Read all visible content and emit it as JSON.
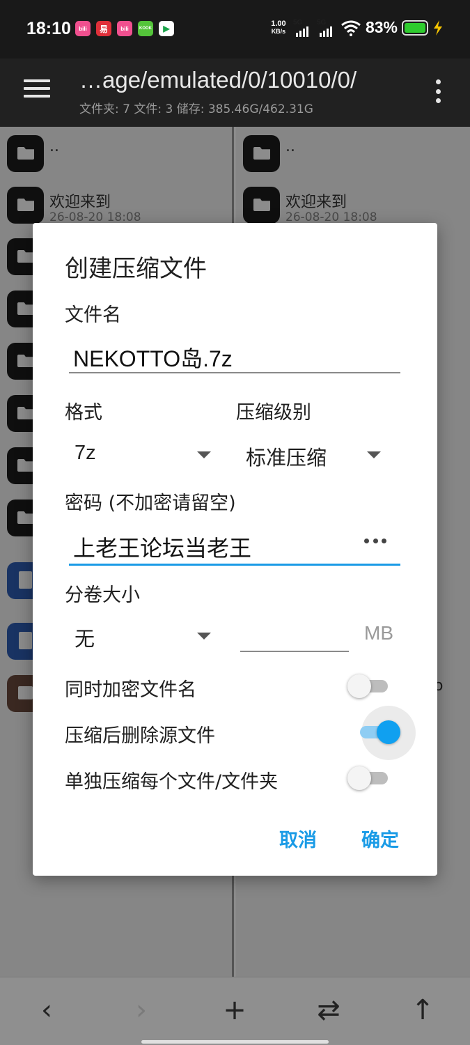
{
  "status_bar": {
    "time": "18:10",
    "app_icons": [
      {
        "name": "bilibili-icon",
        "label": "bili",
        "color": "#f0508f"
      },
      {
        "name": "netease-icon",
        "label": "易",
        "color": "#e0303a"
      },
      {
        "name": "bilibili-icon-2",
        "label": "bili",
        "color": "#f0508f"
      },
      {
        "name": "kook-icon",
        "label": "KOOK",
        "color": "#54c43a"
      },
      {
        "name": "play-store-icon",
        "label": "▶",
        "color": "#ffffff"
      }
    ],
    "net_speed_value": "1.00",
    "net_speed_unit": "KB/s",
    "signal1": "5G",
    "signal2": "5G",
    "battery": "83%",
    "battery_color": "#2ecc2e"
  },
  "appbar": {
    "path": "…age/emulated/0/10010/0/",
    "summary": "文件夹: 7  文件: 3  储存: 385.46G/462.31G"
  },
  "left_pane": {
    "rows": [
      {
        "name": "..",
        "date": ""
      },
      {
        "name": "欢迎来到",
        "date": "26-08-20 18:08"
      }
    ]
  },
  "right_pane": {
    "rows": [
      {
        "name": "..",
        "date": ""
      },
      {
        "name": "欢迎来到",
        "date": "26-08-20 18:08"
      }
    ],
    "fragment": "o"
  },
  "dialog": {
    "title": "创建压缩文件",
    "filename_label": "文件名",
    "filename_value": "NEKOTTO岛.7z",
    "format_label": "格式",
    "format_value": "7z",
    "level_label": "压缩级别",
    "level_value": "标准压缩",
    "password_label": "密码 (不加密请留空)",
    "password_value": "上老王论坛当老王",
    "split_label": "分卷大小",
    "split_value": "无",
    "split_unit": "MB",
    "options": [
      {
        "label": "同时加密文件名",
        "on": false
      },
      {
        "label": "压缩后删除源文件",
        "on": true
      },
      {
        "label": "单独压缩每个文件/文件夹",
        "on": false
      }
    ],
    "cancel": "取消",
    "ok": "确定",
    "accent_color": "#1a9be6"
  },
  "bottom_bar": {
    "back": "‹",
    "forward": "›",
    "add": "+",
    "swap": "⇄",
    "up": "↑"
  }
}
